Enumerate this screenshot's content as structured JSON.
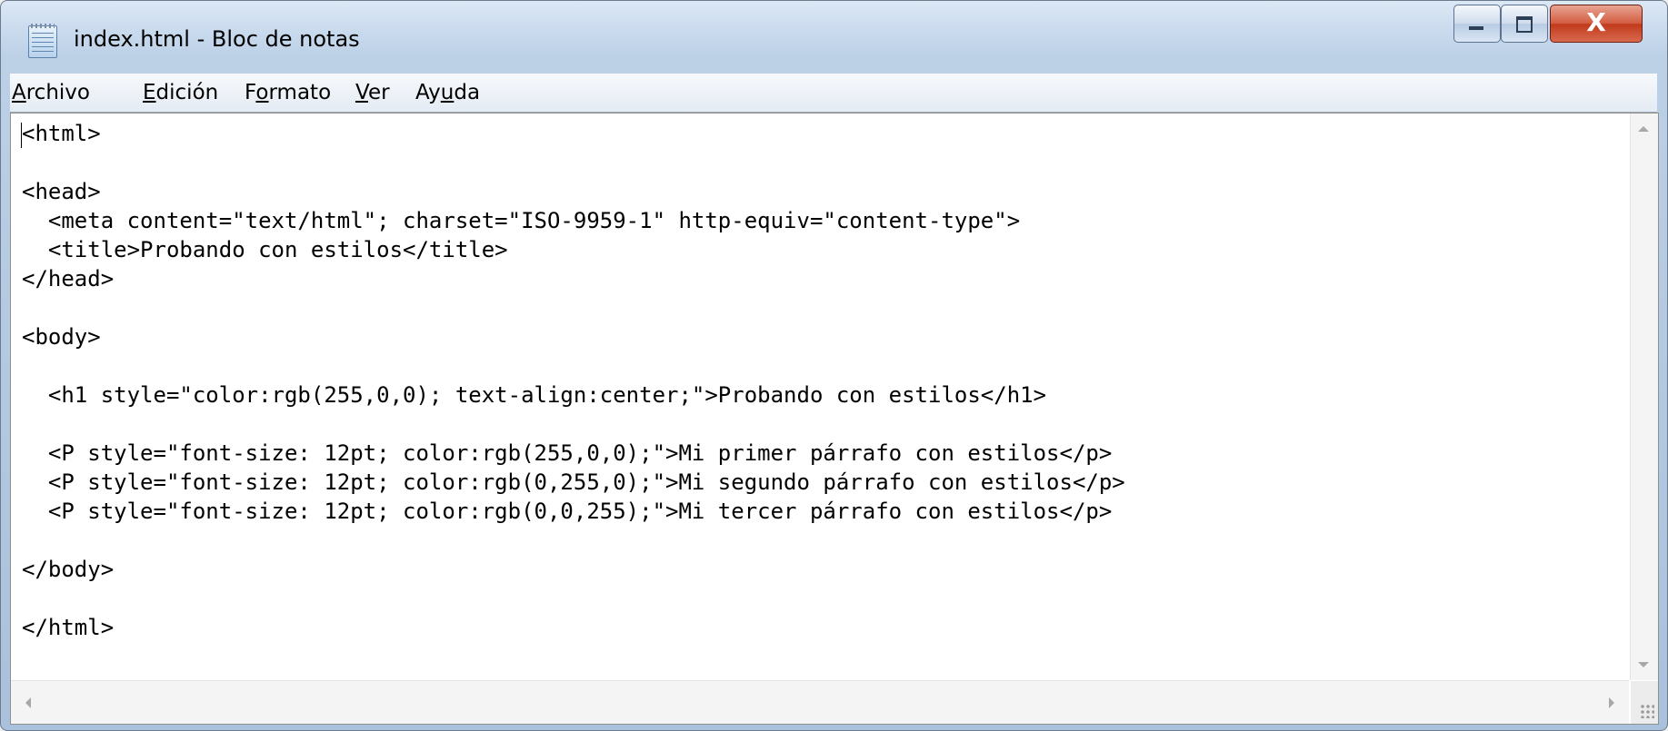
{
  "window": {
    "title": "index.html - Bloc de notas",
    "controls": {
      "minimize": "minimize",
      "maximize": "maximize",
      "close": "X"
    }
  },
  "menu": {
    "items": [
      {
        "label": "Archivo",
        "mnemonic": "A"
      },
      {
        "label": "Edición",
        "mnemonic": "E"
      },
      {
        "label": "Formato",
        "mnemonic": "o"
      },
      {
        "label": "Ver",
        "mnemonic": "V"
      },
      {
        "label": "Ayuda",
        "mnemonic": "u"
      }
    ]
  },
  "editor": {
    "lines": [
      "<html>",
      "",
      "<head>",
      "  <meta content=\"text/html\"; charset=\"ISO-9959-1\" http-equiv=\"content-type\">",
      "  <title>Probando con estilos</title>",
      "</head>",
      "",
      "<body>",
      "",
      "  <h1 style=\"color:rgb(255,0,0); text-align:center;\">Probando con estilos</h1>",
      "",
      "  <P style=\"font-size: 12pt; color:rgb(255,0,0);\">Mi primer párrafo con estilos</p>",
      "  <P style=\"font-size: 12pt; color:rgb(0,255,0);\">Mi segundo párrafo con estilos</p>",
      "  <P style=\"font-size: 12pt; color:rgb(0,0,255);\">Mi tercer párrafo con estilos</p>",
      "",
      "</body>",
      "",
      "</html>"
    ]
  },
  "colors": {
    "titlebar": "#c6d8ec",
    "close_button": "#c0391b",
    "editor_background": "#ffffff"
  },
  "icons": [
    "notepad-icon",
    "minimize-icon",
    "maximize-icon",
    "close-icon"
  ]
}
